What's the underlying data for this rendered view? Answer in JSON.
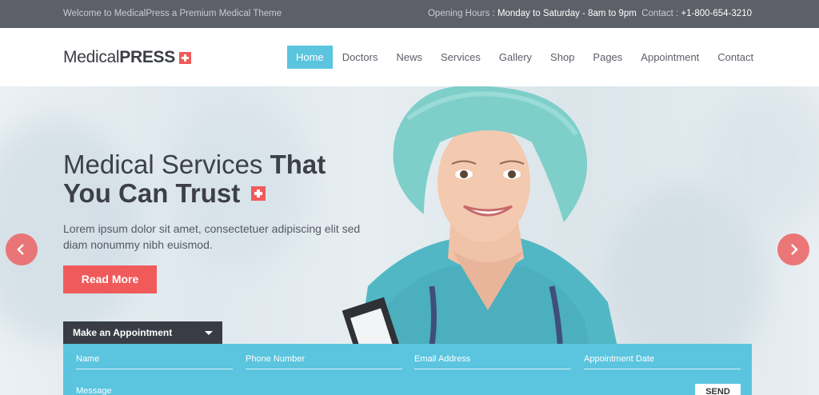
{
  "topbar": {
    "welcome": "Welcome to MedicalPress a Premium Medical Theme",
    "hours_label": "Opening Hours :",
    "hours_value": "Monday to Saturday - 8am to 9pm",
    "contact_label": "Contact :",
    "contact_value": "+1-800-654-3210"
  },
  "logo": {
    "part1": "Medical",
    "part2": "PRESS"
  },
  "nav": {
    "items": [
      {
        "label": "Home"
      },
      {
        "label": "Doctors"
      },
      {
        "label": "News"
      },
      {
        "label": "Services"
      },
      {
        "label": "Gallery"
      },
      {
        "label": "Shop"
      },
      {
        "label": "Pages"
      },
      {
        "label": "Appointment"
      },
      {
        "label": "Contact"
      }
    ],
    "active": "Home"
  },
  "hero": {
    "title_light": "Medical Services ",
    "title_bold_1": "That",
    "title_bold_2": "You Can Trust",
    "text": "Lorem ipsum dolor sit amet, consectetuer adipiscing elit sed diam nonummy nibh euismod.",
    "button": "Read More",
    "prev_icon": "chevron-left-icon",
    "next_icon": "chevron-right-icon"
  },
  "appointment": {
    "tab_label": "Make an Appointment",
    "fields": {
      "name": "Name",
      "phone": "Phone Number",
      "email": "Email Address",
      "date": "Appointment Date",
      "message": "Message"
    },
    "send": "SEND"
  },
  "colors": {
    "accent": "#5bc4de",
    "brand_red": "#f05a5a",
    "topbar": "#5d6069",
    "dark_tab": "#393c44"
  }
}
